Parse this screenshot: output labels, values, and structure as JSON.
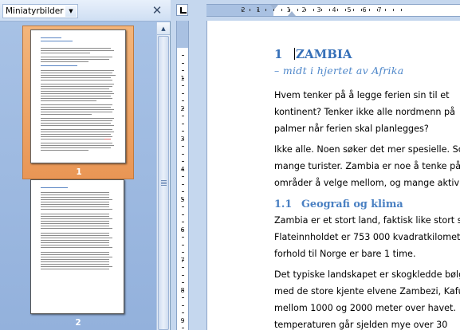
{
  "navigation_pane": {
    "view_selector": "Miniatyrbilder",
    "close_label": "✕",
    "thumbnails": [
      {
        "page_number": "1",
        "selected": true
      },
      {
        "page_number": "2",
        "selected": false
      }
    ]
  },
  "document": {
    "heading1": {
      "number": "1",
      "title": "ZAMBIA"
    },
    "subtitle": "– midt i hjertet av Afrika",
    "paragraph1": [
      "Hvem tenker på å legge ferien sin til et",
      "kontinent? Tenker ikke alle nordmenn på",
      "palmer når ferien skal planlegges?"
    ],
    "paragraph2": [
      "Ikke alle. Noen søker det mer spesielle. Som",
      "mange turister. Zambia er noe å tenke på f",
      "områder å velge mellom, og mange aktivitet"
    ],
    "heading2": {
      "number": "1.1",
      "title": "Geografi og klima"
    },
    "paragraph3": [
      "Zambia er et stort land, faktisk like stort so",
      "Flateinnholdet er 753 000 kvadratkilomet",
      "forhold til Norge er bare 1 time."
    ],
    "paragraph4": [
      "Det typiske landskapet er skogkledde bølge",
      "med de store kjente elvene Zambezi, Kafue",
      "mellom 1000 og 2000 meter over havet.",
      "temperaturen går sjelden mye over 30"
    ]
  },
  "ruler": {
    "horizontal_numbers": [
      "2",
      "1",
      "1",
      "2",
      "3",
      "4",
      "5",
      "6",
      "7"
    ],
    "vertical_numbers": [
      "1",
      "2",
      "3",
      "4",
      "5",
      "6",
      "7",
      "8",
      "9",
      "10"
    ]
  },
  "colors": {
    "heading": "#3670b8",
    "selection_orange": "#e99655",
    "pane_background": "#a9c3e6"
  }
}
